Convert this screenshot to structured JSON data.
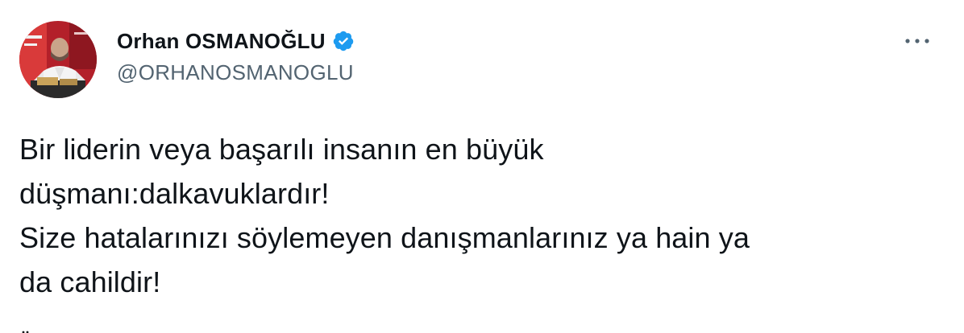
{
  "author": {
    "display_name": "Orhan OSMANOĞLU",
    "handle": "@ORHANOSMANOGLU",
    "verified": true
  },
  "icons": {
    "verified": "verified-badge-icon",
    "more": "more-options-icon"
  },
  "colors": {
    "verified_blue": "#1d9bf0",
    "text_primary": "#0f1419",
    "text_secondary": "#536471"
  },
  "tweet": {
    "lines": [
      "Bir liderin veya başarılı insanın en büyük",
      "düşmanı:dalkavuklardır!",
      "Size hatalarınızı söylemeyen danışmanlarınız ya hain ya",
      "da cahildir!"
    ]
  }
}
